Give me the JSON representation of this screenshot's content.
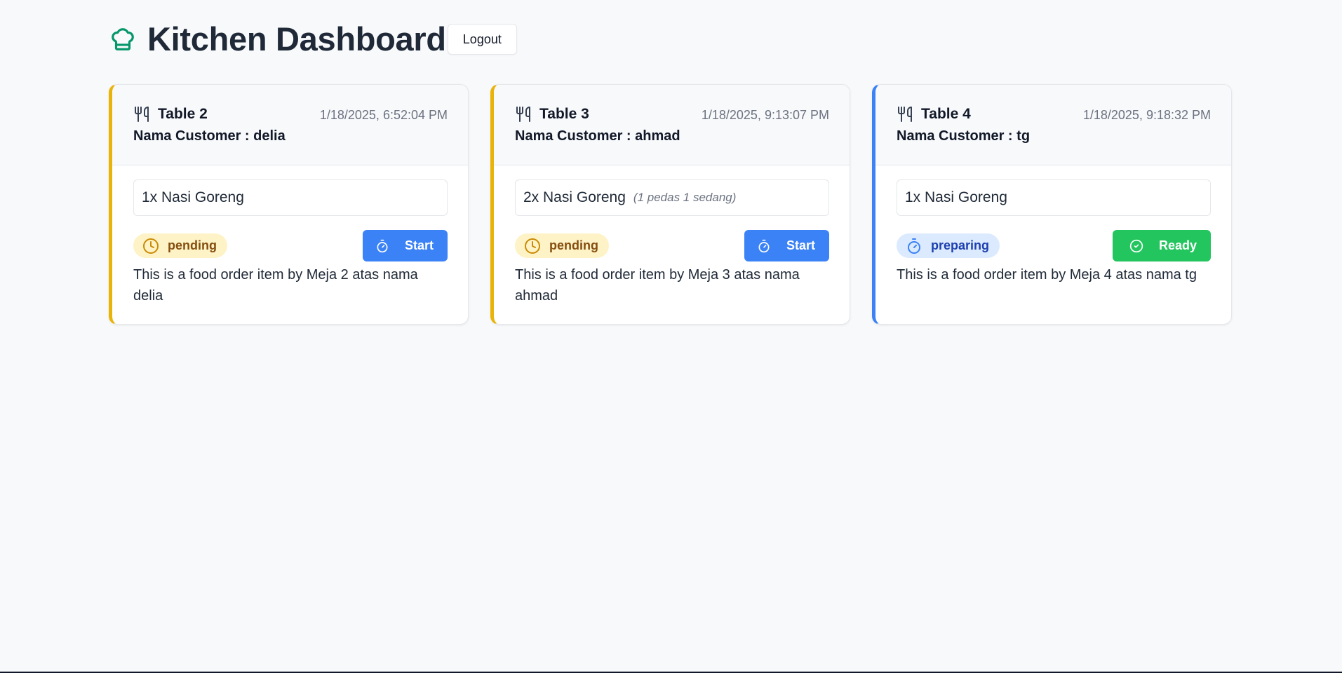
{
  "header": {
    "title": "Kitchen Dashboard",
    "logout_label": "Logout",
    "icon": "chef-hat-icon",
    "accent_color": "#059669"
  },
  "orders": [
    {
      "table": "Table 2",
      "customer": "Nama Customer : delia",
      "timestamp": "1/18/2025, 6:52:04 PM",
      "item": "1x Nasi Goreng",
      "note": "",
      "status": "pending",
      "status_icon": "clock-icon",
      "action_label": "Start",
      "action_icon": "timer-icon",
      "description": "This is a food order item by Meja 2 atas nama delia",
      "accent_color": "#eab308"
    },
    {
      "table": "Table 3",
      "customer": "Nama Customer : ahmad",
      "timestamp": "1/18/2025, 9:13:07 PM",
      "item": "2x Nasi Goreng",
      "note": "(1 pedas 1 sedang)",
      "status": "pending",
      "status_icon": "clock-icon",
      "action_label": "Start",
      "action_icon": "timer-icon",
      "description": "This is a food order item by Meja 3 atas nama ahmad",
      "accent_color": "#eab308"
    },
    {
      "table": "Table 4",
      "customer": "Nama Customer : tg",
      "timestamp": "1/18/2025, 9:18:32 PM",
      "item": "1x Nasi Goreng",
      "note": "",
      "status": "preparing",
      "status_icon": "timer-icon",
      "action_label": "Ready",
      "action_icon": "check-circle-icon",
      "description": "This is a food order item by Meja 4 atas nama tg",
      "accent_color": "#3b82f6"
    }
  ],
  "colors": {
    "start_button": "#3b82f6",
    "ready_button": "#22c55e",
    "pending_badge_bg": "#fef3c7",
    "preparing_badge_bg": "#dbeafe"
  }
}
